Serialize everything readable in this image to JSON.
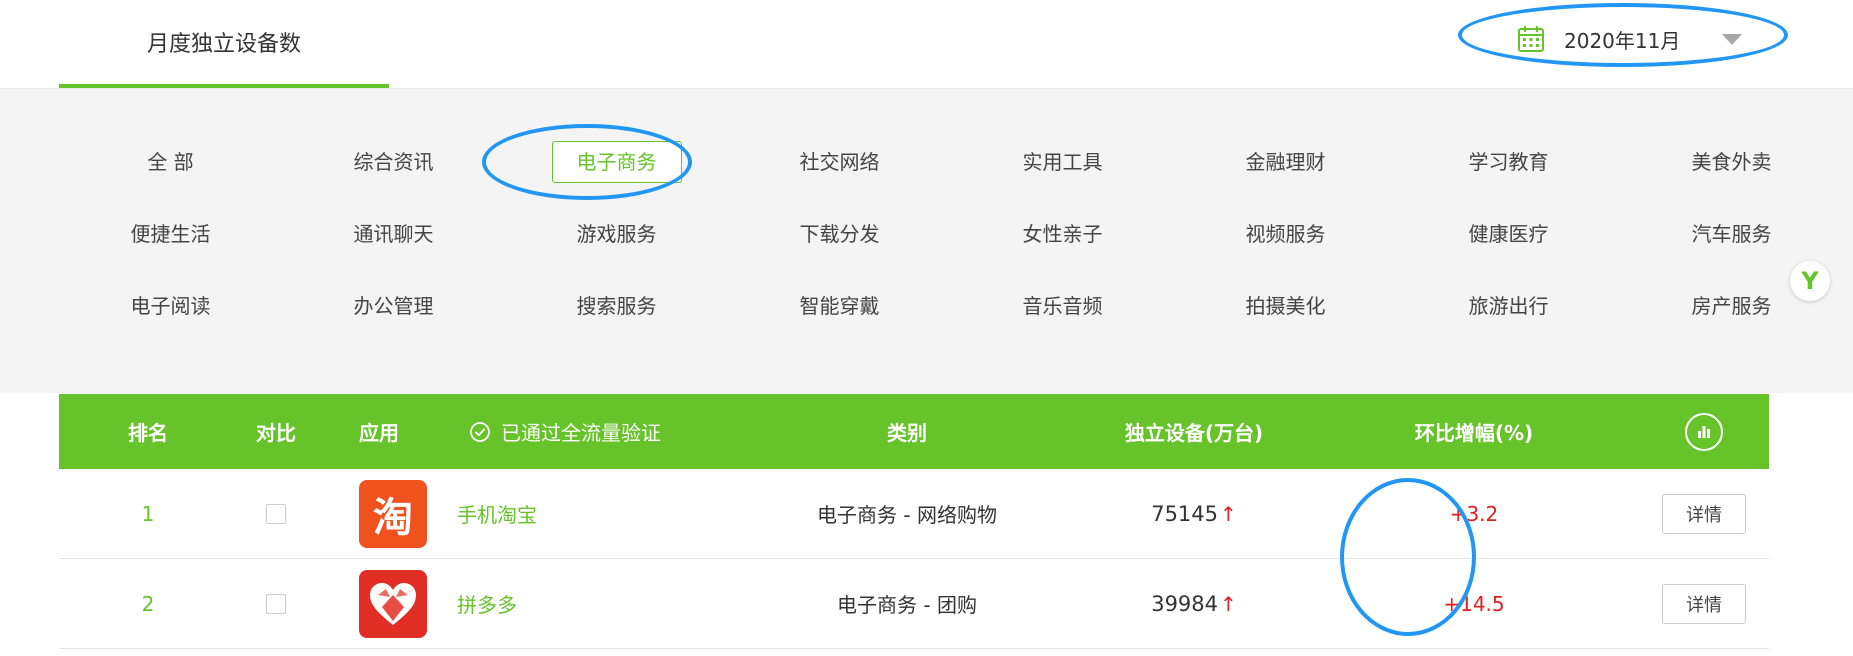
{
  "header": {
    "active_tab": "月度独立设备数",
    "date_value": "2020年11月"
  },
  "categories": [
    {
      "label": "全 部"
    },
    {
      "label": "综合资讯"
    },
    {
      "label": "电子商务",
      "selected": true
    },
    {
      "label": "社交网络"
    },
    {
      "label": "实用工具"
    },
    {
      "label": "金融理财"
    },
    {
      "label": "学习教育"
    },
    {
      "label": "美食外卖"
    },
    {
      "label": "便捷生活"
    },
    {
      "label": "通讯聊天"
    },
    {
      "label": "游戏服务"
    },
    {
      "label": "下载分发"
    },
    {
      "label": "女性亲子"
    },
    {
      "label": "视频服务"
    },
    {
      "label": "健康医疗"
    },
    {
      "label": "汽车服务"
    },
    {
      "label": "电子阅读"
    },
    {
      "label": "办公管理"
    },
    {
      "label": "搜索服务"
    },
    {
      "label": "智能穿戴"
    },
    {
      "label": "音乐音频"
    },
    {
      "label": "拍摄美化"
    },
    {
      "label": "旅游出行"
    },
    {
      "label": "房产服务"
    }
  ],
  "side_badge": "Y",
  "table": {
    "headers": {
      "rank": "排名",
      "compare": "对比",
      "app": "应用",
      "verified": "已通过全流量验证",
      "category": "类别",
      "devices": "独立设备(万台)",
      "growth": "环比增幅(%)"
    },
    "rows": [
      {
        "rank": "1",
        "icon_glyph": "淘",
        "icon_color": "#f0521e",
        "app": "手机淘宝",
        "category": "电子商务 - 网络购物",
        "devices": "75145",
        "trend": "↑",
        "growth": "+3.2",
        "detail": "详情"
      },
      {
        "rank": "2",
        "icon_glyph": "",
        "icon_color": "#e02e24",
        "app": "拼多多",
        "category": "电子商务 - 团购",
        "devices": "39984",
        "trend": "↑",
        "growth": "+14.5",
        "detail": "详情"
      }
    ]
  },
  "colors": {
    "brand_green": "#66c32a",
    "highlight_blue": "#2196f3",
    "growth_red": "#e02020"
  }
}
